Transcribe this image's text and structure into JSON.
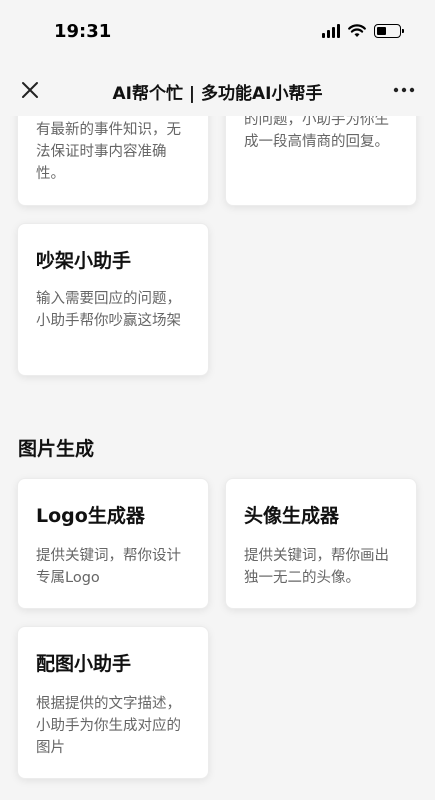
{
  "status_bar": {
    "time": "19:31"
  },
  "nav": {
    "title": "AI帮个忙 | 多功能AI小帮手",
    "close_icon": "close-icon",
    "more_icon": "more-icon"
  },
  "partial_cards": [
    {
      "desc": "有最新的事件知识，无法保证时事内容准确性。"
    },
    {
      "desc": "的问题，小助手为你生成一段高情商的回复。"
    }
  ],
  "quarrel_card": {
    "title": "吵架小助手",
    "desc": "输入需要回应的问题，小助手帮你吵赢这场架"
  },
  "image_section": {
    "title": "图片生成",
    "cards": [
      {
        "title": "Logo生成器",
        "desc": "提供关键词，帮你设计专属Logo"
      },
      {
        "title": "头像生成器",
        "desc": "提供关键词，帮你画出独一无二的头像。"
      },
      {
        "title": "配图小助手",
        "desc": "根据提供的文字描述，小助手为你生成对应的图片"
      }
    ]
  }
}
